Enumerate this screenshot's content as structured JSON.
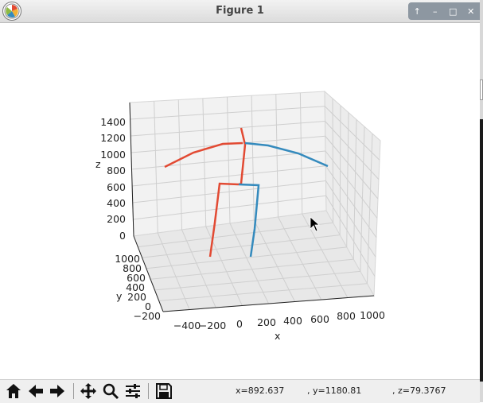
{
  "window": {
    "title": "Figure 1",
    "controls": [
      "↑",
      "–",
      "□",
      "✕"
    ]
  },
  "icons": {
    "app": "matplotlib-logo-icon",
    "toolbar": [
      "home-icon",
      "back-arrow-icon",
      "forward-arrow-icon",
      "pan-move-icon",
      "zoom-magnifier-icon",
      "configure-subplots-icon",
      "save-floppy-icon"
    ],
    "cursor": "mouse-pointer-icon"
  },
  "status": {
    "x": "x=892.637",
    "y": ", y=1180.81",
    "z": ", z=79.3767"
  },
  "chart_data": {
    "type": "line3d",
    "xlabel": "x",
    "ylabel": "y",
    "zlabel": "z",
    "x_ticks": [
      "−400",
      "−200",
      "0",
      "200",
      "400",
      "600",
      "800",
      "1000"
    ],
    "y_ticks": [
      "−200",
      "0",
      "200",
      "400",
      "600",
      "800",
      "1000"
    ],
    "z_ticks": [
      "0",
      "200",
      "400",
      "600",
      "800",
      "1000",
      "1200",
      "1400"
    ],
    "grid": true,
    "series": [
      {
        "color": "#e24a33",
        "segments": "left-side skeleton limbs"
      },
      {
        "color": "#348abd",
        "segments": "right-side skeleton limbs"
      }
    ]
  }
}
